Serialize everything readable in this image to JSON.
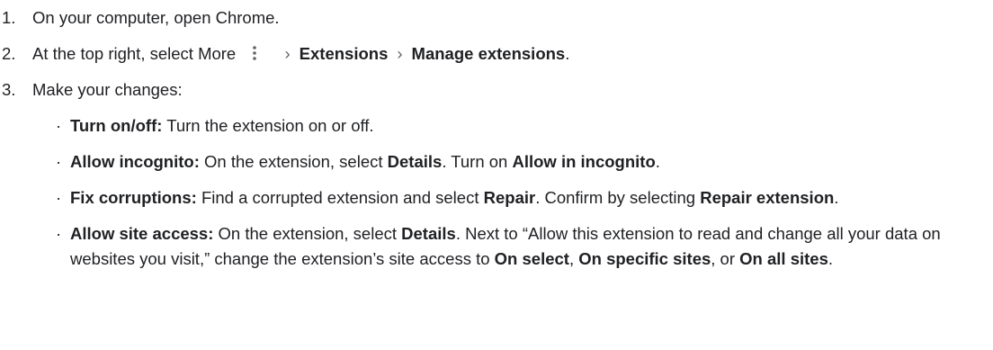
{
  "steps": [
    {
      "num": "1.",
      "text": "On your computer, open Chrome."
    },
    {
      "num": "2.",
      "prefix": "At the top right, select More",
      "icon": "more-vert-icon",
      "sep": "›",
      "crumb1": "Extensions",
      "crumb2": "Manage extensions",
      "suffix": "."
    },
    {
      "num": "3.",
      "text": "Make your changes:"
    }
  ],
  "sub": [
    {
      "title": "Turn on/off:",
      "text": " Turn the extension on or off."
    },
    {
      "title": "Allow incognito:",
      "t1": " On the extension, select ",
      "b1": "Details",
      "t2": ". Turn on ",
      "b2": "Allow in incognito",
      "t3": "."
    },
    {
      "title": "Fix corruptions:",
      "t1": " Find a corrupted extension and select ",
      "b1": "Repair",
      "t2": ". Confirm by selecting ",
      "b2": "Repair extension",
      "t3": "."
    },
    {
      "title": "Allow site access:",
      "t1": " On the extension, select ",
      "b1": "Details",
      "t2": ". Next to “Allow this extension to read and change all your data on websites you visit,” change the extension’s site access to ",
      "b2": "On select",
      "t3": ", ",
      "b3": "On specific sites",
      "t4": ", or ",
      "b4": "On all sites",
      "t5": "."
    }
  ]
}
